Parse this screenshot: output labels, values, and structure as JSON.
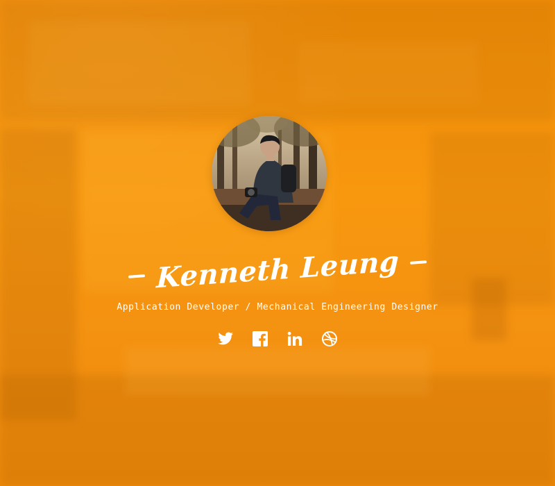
{
  "profile": {
    "name": "Kenneth Leung",
    "subtitle": "Application Developer / Mechanical Engineering Designer",
    "avatar_alt": "Profile photo"
  },
  "social": [
    {
      "name": "twitter",
      "icon": "twitter-icon"
    },
    {
      "name": "facebook",
      "icon": "facebook-icon"
    },
    {
      "name": "linkedin",
      "icon": "linkedin-icon"
    },
    {
      "name": "dribbble",
      "icon": "dribbble-icon"
    }
  ],
  "colors": {
    "accent": "#f7930f",
    "text": "#ffffff"
  }
}
